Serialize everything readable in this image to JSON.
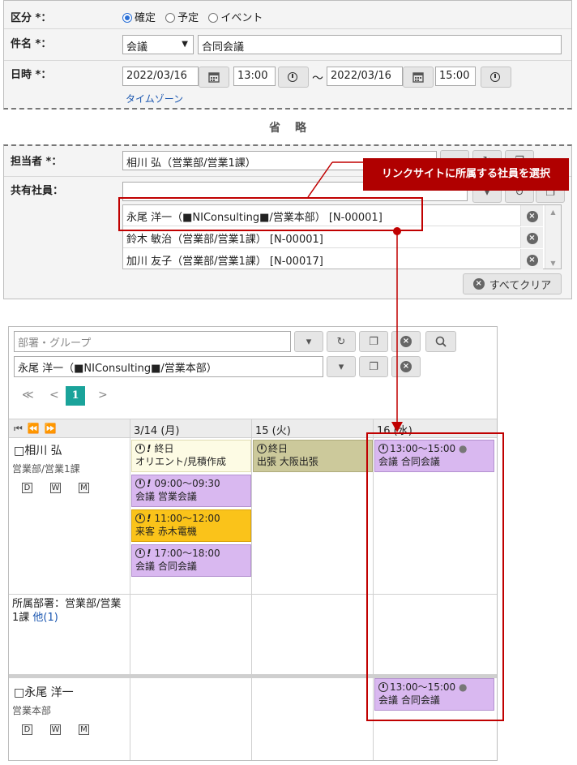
{
  "form": {
    "category_label": "区分 *：",
    "category_options": [
      "確定",
      "予定",
      "イベント"
    ],
    "category_selected": "確定",
    "subject_label": "件名 *：",
    "subject_type": "会議",
    "subject_value": "合同会議",
    "datetime_label": "日時 *：",
    "start_date": "2022/03/16",
    "start_time": "13:00",
    "range_sep": "～",
    "end_date": "2022/03/16",
    "end_time": "15:00",
    "timezone_link": "タイムゾーン",
    "omitted": "省　略",
    "assignee_label": "担当者 *：",
    "assignee_value": "相川 弘（営業部/営業1課）",
    "shared_label": "共有社員：",
    "shared_list": [
      "永尾 洋一（■NIConsulting■/営業本部） [N-00001]",
      "鈴木 敏治（営業部/営業1課） [N-00001]",
      "加川 友子（営業部/営業1課） [N-00017]"
    ],
    "clear_all": "すべてクリア"
  },
  "callout": "リンクサイトに所属する社員を選択",
  "schedule": {
    "group_placeholder": "部署・グループ",
    "person_select": "永尾 洋一（■NIConsulting■/営業本部）",
    "pager_first": "≪",
    "pager_prev": "<",
    "pager_current": "1",
    "pager_next": ">",
    "days": [
      "3/14 (月)",
      "15 (火)",
      "16 (水)"
    ],
    "rows": [
      {
        "name": "□相川 弘",
        "dept": "営業部/営業1課",
        "views": [
          "D",
          "W",
          "M"
        ],
        "day1": [
          {
            "time": "終日",
            "title": "オリエント/見積作成",
            "color": "cream",
            "important": true
          },
          {
            "time": "09:00～09:30",
            "title": "会議 営業会議",
            "color": "purple",
            "important": true
          },
          {
            "time": "11:00～12:00",
            "title": "来客 赤木電機",
            "color": "yellow",
            "important": true
          },
          {
            "time": "17:00～18:00",
            "title": "会議 合同会議",
            "color": "purple",
            "important": true
          }
        ],
        "day2": {
          "time": "終日",
          "title": "出張 大阪出張",
          "color": "khaki"
        },
        "day3": {
          "time": "13:00～15:00",
          "title": "会議 合同会議",
          "color": "purple"
        }
      },
      {
        "dept_text": "所属部署：営業部/営業1課",
        "more_link": "他(1)"
      },
      {
        "name": "□永尾 洋一",
        "dept": "営業本部",
        "views": [
          "D",
          "W",
          "M"
        ],
        "day3": {
          "time": "13:00～15:00",
          "title": "会議 合同会議",
          "color": "purple"
        }
      }
    ]
  },
  "colors": {
    "accent_red": "#c00000",
    "event_purple": "#d9b8f0",
    "event_yellow": "#fac31a",
    "event_khaki": "#ccc99b",
    "pager_active": "#1aa39a"
  }
}
